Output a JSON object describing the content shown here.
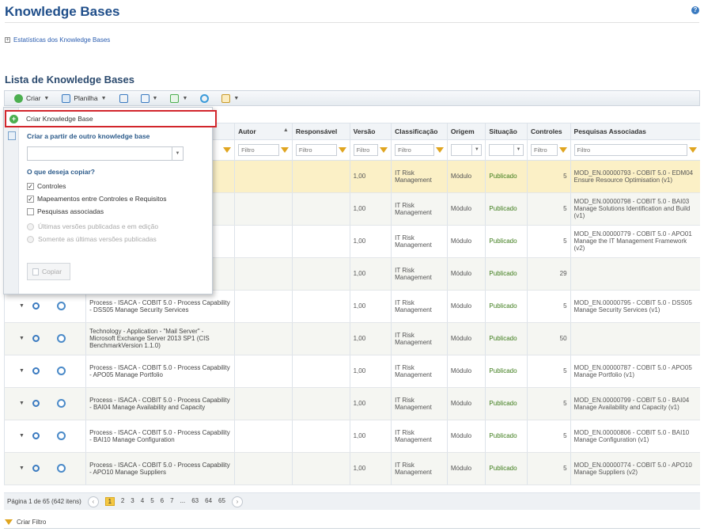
{
  "page": {
    "title": "Knowledge Bases",
    "help_icon": "help-icon"
  },
  "stats_link": {
    "label": "Estatísticas dos Knowledge Bases"
  },
  "section_title": "Lista de Knowledge Bases",
  "toolbar": {
    "create_label": "Criar",
    "sheet_label": "Planilha"
  },
  "columns": [
    "Autor",
    "Responsável",
    "Versão",
    "Classificação",
    "Origem",
    "Situação",
    "Controles",
    "Pesquisas Associadas"
  ],
  "filter_placeholder": "Filtro",
  "rows": [
    {
      "name": "",
      "version": "1,00",
      "class": "IT Risk Management",
      "origin": "Módulo",
      "status": "Publicado",
      "controls": "5",
      "research": "MOD_EN.00000793 - COBIT 5.0 - EDM04 Ensure Resource Optimisation (v1)",
      "style": "hl"
    },
    {
      "name": "",
      "version": "1,00",
      "class": "IT Risk Management",
      "origin": "Módulo",
      "status": "Publicado",
      "controls": "5",
      "research": "MOD_EN.00000798 - COBIT 5.0 - BAI03 Manage Solutions Identification and Build (v1)",
      "style": "alt"
    },
    {
      "name": "",
      "version": "1,00",
      "class": "IT Risk Management",
      "origin": "Módulo",
      "status": "Publicado",
      "controls": "5",
      "research": "MOD_EN.00000779 - COBIT 5.0 - APO01 Manage the IT Management Framework (v2)",
      "style": ""
    },
    {
      "name": "",
      "version": "1,00",
      "class": "IT Risk Management",
      "origin": "Módulo",
      "status": "Publicado",
      "controls": "29",
      "research": "",
      "style": "alt"
    },
    {
      "name": "Process - ISACA - COBIT 5.0 - Process Capability - DSS05 Manage Security Services",
      "version": "1,00",
      "class": "IT Risk Management",
      "origin": "Módulo",
      "status": "Publicado",
      "controls": "5",
      "research": "MOD_EN.00000795 - COBIT 5.0 - DSS05 Manage Security Services (v1)",
      "style": ""
    },
    {
      "name": "Technology - Application - \"Mail Server\" - Microsoft Exchange Server 2013 SP1 (CIS BenchmarkVersion 1.1.0)",
      "version": "1,00",
      "class": "IT Risk Management",
      "origin": "Módulo",
      "status": "Publicado",
      "controls": "50",
      "research": "",
      "style": "alt"
    },
    {
      "name": "Process - ISACA - COBIT 5.0 - Process Capability - APO05 Manage Portfolio",
      "version": "1,00",
      "class": "IT Risk Management",
      "origin": "Módulo",
      "status": "Publicado",
      "controls": "5",
      "research": "MOD_EN.00000787 - COBIT 5.0 - APO05 Manage Portfolio (v1)",
      "style": ""
    },
    {
      "name": "Process - ISACA - COBIT 5.0 - Process Capability - BAI04 Manage Availability and Capacity",
      "version": "1,00",
      "class": "IT Risk Management",
      "origin": "Módulo",
      "status": "Publicado",
      "controls": "5",
      "research": "MOD_EN.00000799 - COBIT 5.0 - BAI04 Manage Availability and Capacity (v1)",
      "style": "alt"
    },
    {
      "name": "Process - ISACA - COBIT 5.0 - Process Capability - BAI10 Manage Configuration",
      "version": "1,00",
      "class": "IT Risk Management",
      "origin": "Módulo",
      "status": "Publicado",
      "controls": "5",
      "research": "MOD_EN.00000806 - COBIT 5.0 - BAI10 Manage Configuration (v1)",
      "style": ""
    },
    {
      "name": "Process - ISACA - COBIT 5.0 - Process Capability - APO10 Manage Suppliers",
      "version": "1,00",
      "class": "IT Risk Management",
      "origin": "Módulo",
      "status": "Publicado",
      "controls": "5",
      "research": "MOD_EN.00000774 - COBIT 5.0 - APO10 Manage Suppliers (v2)",
      "style": "alt"
    }
  ],
  "dropdown": {
    "create_kb": "Criar Knowledge Base",
    "from_other": "Criar a partir de outro knowledge base",
    "question": "O que deseja copiar?",
    "opt_controls": "Controles",
    "opt_mappings": "Mapeamentos entre Controles e Requisitos",
    "opt_research": "Pesquisas associadas",
    "radio_last_pub_edit": "Últimas versões publicadas e em edição",
    "radio_last_pub": "Somente as últimas versões publicadas",
    "copy_button": "Copiar"
  },
  "pager": {
    "summary": "Página 1 de 65 (642 itens)",
    "pages": [
      "1",
      "2",
      "3",
      "4",
      "5",
      "6",
      "7",
      "...",
      "63",
      "64",
      "65"
    ],
    "current": "1"
  },
  "create_filter": "Criar Filtro"
}
